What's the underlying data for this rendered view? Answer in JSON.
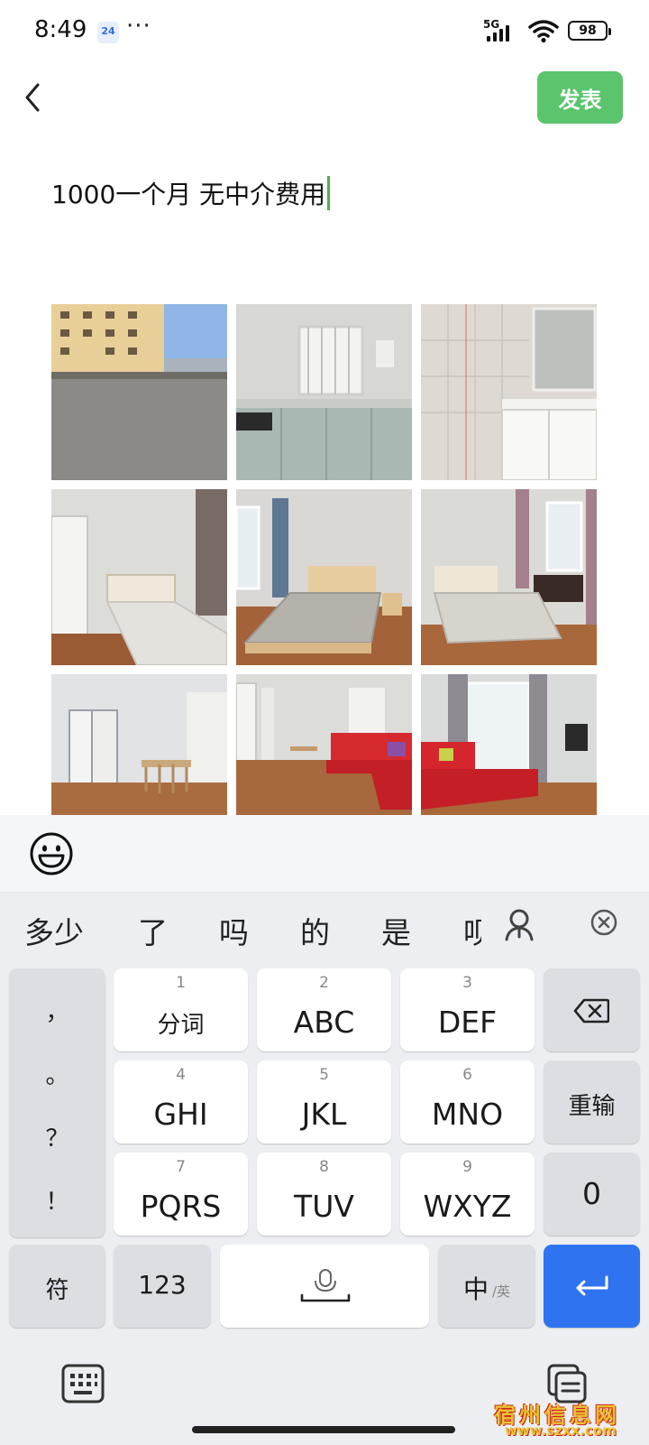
{
  "status_bar": {
    "time": "8:49",
    "badge": "24",
    "more": "···",
    "network": "5G",
    "battery": "98"
  },
  "header": {
    "publish_label": "发表"
  },
  "post": {
    "text": "1000一个月 无中介费用"
  },
  "photos": [
    "rooftop-terrace-photo",
    "kitchen-photo",
    "bathroom-photo",
    "bedroom-photo-1",
    "bedroom-photo-2",
    "bedroom-photo-3",
    "dining-room-photo",
    "living-room-sofa-photo",
    "living-room-balcony-photo"
  ],
  "candidates": [
    "多少",
    "了",
    "吗",
    "的",
    "是",
    "呗"
  ],
  "keyboard": {
    "punctuation": [
      "，",
      "。",
      "？",
      "！"
    ],
    "keys": [
      {
        "num": "1",
        "label": "分词"
      },
      {
        "num": "2",
        "label": "ABC"
      },
      {
        "num": "3",
        "label": "DEF"
      },
      {
        "num": "4",
        "label": "GHI"
      },
      {
        "num": "5",
        "label": "JKL"
      },
      {
        "num": "6",
        "label": "MNO"
      },
      {
        "num": "7",
        "label": "PQRS"
      },
      {
        "num": "8",
        "label": "TUV"
      },
      {
        "num": "9",
        "label": "WXYZ"
      }
    ],
    "reinput_label": "重输",
    "zero_label": "0",
    "symbol_label": "符",
    "numbers_label": "123",
    "lang_main": "中",
    "lang_alt": "/英"
  },
  "watermark": {
    "name": "宿州信息网",
    "url": "www.szxx.com"
  },
  "colors": {
    "accent_green": "#5ac56c",
    "enter_blue": "#2f73f0",
    "caret_green": "#4caf50"
  }
}
